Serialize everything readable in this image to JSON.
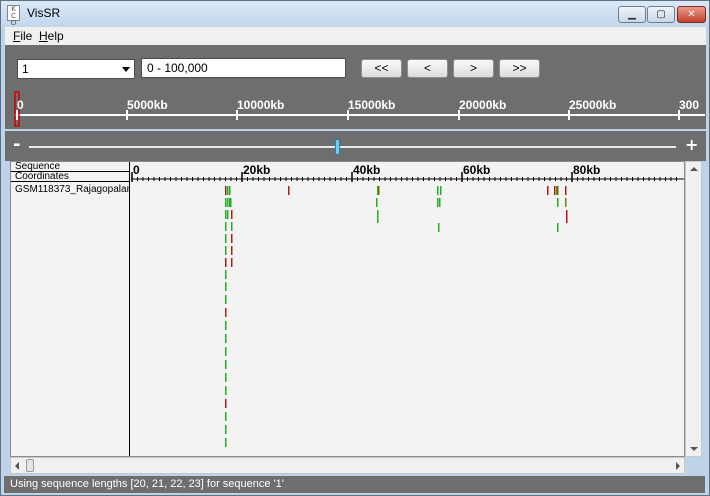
{
  "window": {
    "title": "VisSR",
    "icon_text": "K\nC\nO",
    "minimize_symbol": "▁",
    "maximize_symbol": "▢",
    "close_symbol": "✕"
  },
  "menu": [
    {
      "label_ul": "F",
      "label_rest": "ile"
    },
    {
      "label_ul": "H",
      "label_rest": "elp"
    }
  ],
  "toolbar": {
    "sequence_value": "1",
    "range_value": "0 - 100,000",
    "buttons": [
      "<<",
      "<",
      ">",
      ">>"
    ]
  },
  "overview": {
    "tick_labels": [
      "0",
      "5000kb",
      "10000kb",
      "15000kb",
      "20000kb",
      "25000kb",
      "300"
    ],
    "selection_marker_color": "#cc0000"
  },
  "zoom": {
    "minus_label": "-",
    "plus_label": "+",
    "level_fraction": 0.476
  },
  "labels": {
    "sequence": "Sequence",
    "coordinates": "Coordinates",
    "track": "GSM118373_Rajagopalan"
  },
  "ruler": {
    "tick_labels": [
      "0",
      "20kb",
      "40kb",
      "60kb",
      "80kb"
    ]
  },
  "colors": {
    "forward_read": "#22b022",
    "reverse_read": "#b01a1a",
    "panel_bg": "#6e6e6e",
    "thumb": "#6fcff0"
  },
  "status": {
    "text": "Using sequence lengths [20, 21, 22, 23] for sequence '1'"
  }
}
